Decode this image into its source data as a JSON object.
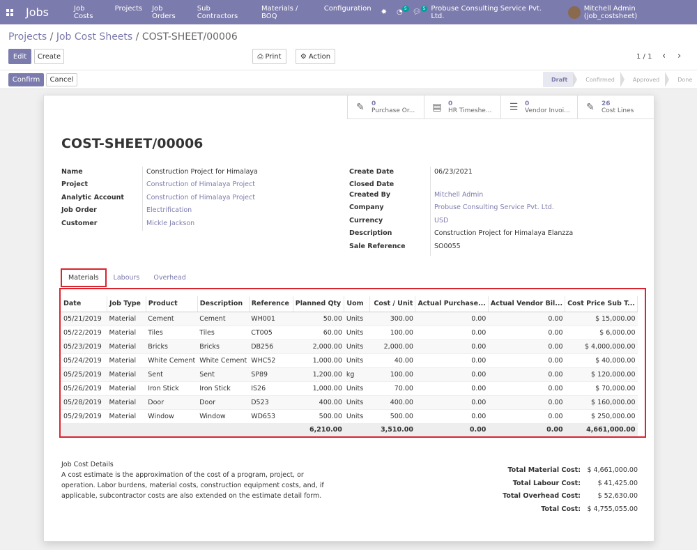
{
  "app": {
    "title": "Jobs",
    "menu": [
      "Job Costs",
      "Projects",
      "Job Orders",
      "Sub Contractors",
      "Materials / BOQ",
      "Configuration"
    ],
    "activity_count": "5",
    "message_count": "5",
    "company": "Probuse Consulting Service Pvt. Ltd.",
    "user": "Mitchell Admin (job_costsheet)"
  },
  "breadcrumb": {
    "projects": "Projects",
    "sheets": "Job Cost Sheets",
    "current": "COST-SHEET/00006",
    "sep": "/"
  },
  "buttons": {
    "edit": "Edit",
    "create": "Create",
    "print": "Print",
    "action": "Action",
    "confirm": "Confirm",
    "cancel": "Cancel"
  },
  "pager": "1 / 1",
  "stages": [
    "Draft",
    "Confirmed",
    "Approved",
    "Done"
  ],
  "smart_buttons": [
    {
      "count": "0",
      "label": "Purchase Or...",
      "icon": "edit-icon"
    },
    {
      "count": "0",
      "label": "HR Timeshe...",
      "icon": "book-icon"
    },
    {
      "count": "0",
      "label": "Vendor Invoi...",
      "icon": "list-icon"
    },
    {
      "count": "26",
      "label": "Cost Lines",
      "icon": "edit-icon"
    }
  ],
  "record": {
    "title": "COST-SHEET/00006",
    "left_fields": [
      {
        "label": "Name",
        "value": "Construction Project for Himalaya",
        "link": false
      },
      {
        "label": "Project",
        "value": "Construction of Himalaya Project",
        "link": true
      },
      {
        "label": "Analytic Account",
        "value": "Construction of Himalaya Project",
        "link": true
      },
      {
        "label": "Job Order",
        "value": "Electrification",
        "link": true
      },
      {
        "label": "Customer",
        "value": "Mickle Jackson",
        "link": true
      }
    ],
    "right_fields": [
      {
        "label": "Create Date",
        "value": "06/23/2021",
        "link": false
      },
      {
        "label": "Closed Date",
        "value": "",
        "link": false
      },
      {
        "label": "Created By",
        "value": "Mitchell Admin",
        "link": true
      },
      {
        "label": "Company",
        "value": "Probuse Consulting Service Pvt. Ltd.",
        "link": true
      },
      {
        "label": "Currency",
        "value": "USD",
        "link": true
      },
      {
        "label": "Description",
        "value": "Construction Project for Himalaya Elanzza",
        "link": false
      },
      {
        "label": "Sale Reference",
        "value": "SO0055",
        "link": false
      }
    ]
  },
  "tabs": [
    "Materials",
    "Labours",
    "Overhead"
  ],
  "materials": {
    "columns": [
      "Date",
      "Job Type",
      "Product",
      "Description",
      "Reference",
      "Planned Qty",
      "Uom",
      "Cost / Unit",
      "Actual Purchase...",
      "Actual Vendor Bil...",
      "Cost Price Sub T..."
    ],
    "rows": [
      [
        "05/21/2019",
        "Material",
        "Cement",
        "Cement",
        "WH001",
        "50.00",
        "Units",
        "300.00",
        "0.00",
        "0.00",
        "$ 15,000.00"
      ],
      [
        "05/22/2019",
        "Material",
        "Tiles",
        "Tiles",
        "CT005",
        "60.00",
        "Units",
        "100.00",
        "0.00",
        "0.00",
        "$ 6,000.00"
      ],
      [
        "05/23/2019",
        "Material",
        "Bricks",
        "Bricks",
        "DB256",
        "2,000.00",
        "Units",
        "2,000.00",
        "0.00",
        "0.00",
        "$ 4,000,000.00"
      ],
      [
        "05/24/2019",
        "Material",
        "White Cement",
        "White Cement",
        "WHC52",
        "1,000.00",
        "Units",
        "40.00",
        "0.00",
        "0.00",
        "$ 40,000.00"
      ],
      [
        "05/25/2019",
        "Material",
        "Sent",
        "Sent",
        "SP89",
        "1,200.00",
        "kg",
        "100.00",
        "0.00",
        "0.00",
        "$ 120,000.00"
      ],
      [
        "05/26/2019",
        "Material",
        "Iron Stick",
        "Iron Stick",
        "IS26",
        "1,000.00",
        "Units",
        "70.00",
        "0.00",
        "0.00",
        "$ 70,000.00"
      ],
      [
        "05/28/2019",
        "Material",
        "Door",
        "Door",
        "D523",
        "400.00",
        "Units",
        "400.00",
        "0.00",
        "0.00",
        "$ 160,000.00"
      ],
      [
        "05/29/2019",
        "Material",
        "Window",
        "Window",
        "WD653",
        "500.00",
        "Units",
        "500.00",
        "0.00",
        "0.00",
        "$ 250,000.00"
      ]
    ],
    "totals": {
      "planned_qty": "6,210.00",
      "cost_unit": "3,510.00",
      "actual_purchase": "0.00",
      "actual_vendor": "0.00",
      "subtotal": "4,661,000.00"
    }
  },
  "notes": {
    "heading": "Job Cost Details",
    "body": "A cost estimate is the approximation of the cost of a program, project, or operation. Labor burdens, material costs, construction equipment costs, and, if applicable, subcontractor costs are also extended on the estimate detail form."
  },
  "summary": [
    {
      "label": "Total Material Cost:",
      "value": "$ 4,661,000.00"
    },
    {
      "label": "Total Labour Cost:",
      "value": "$ 41,425.00"
    },
    {
      "label": "Total Overhead Cost:",
      "value": "$ 52,630.00"
    },
    {
      "label": "Total Cost:",
      "value": "$ 4,755,055.00"
    }
  ],
  "colors": {
    "brand": "#7c7bad",
    "highlight": "#d9232e"
  }
}
